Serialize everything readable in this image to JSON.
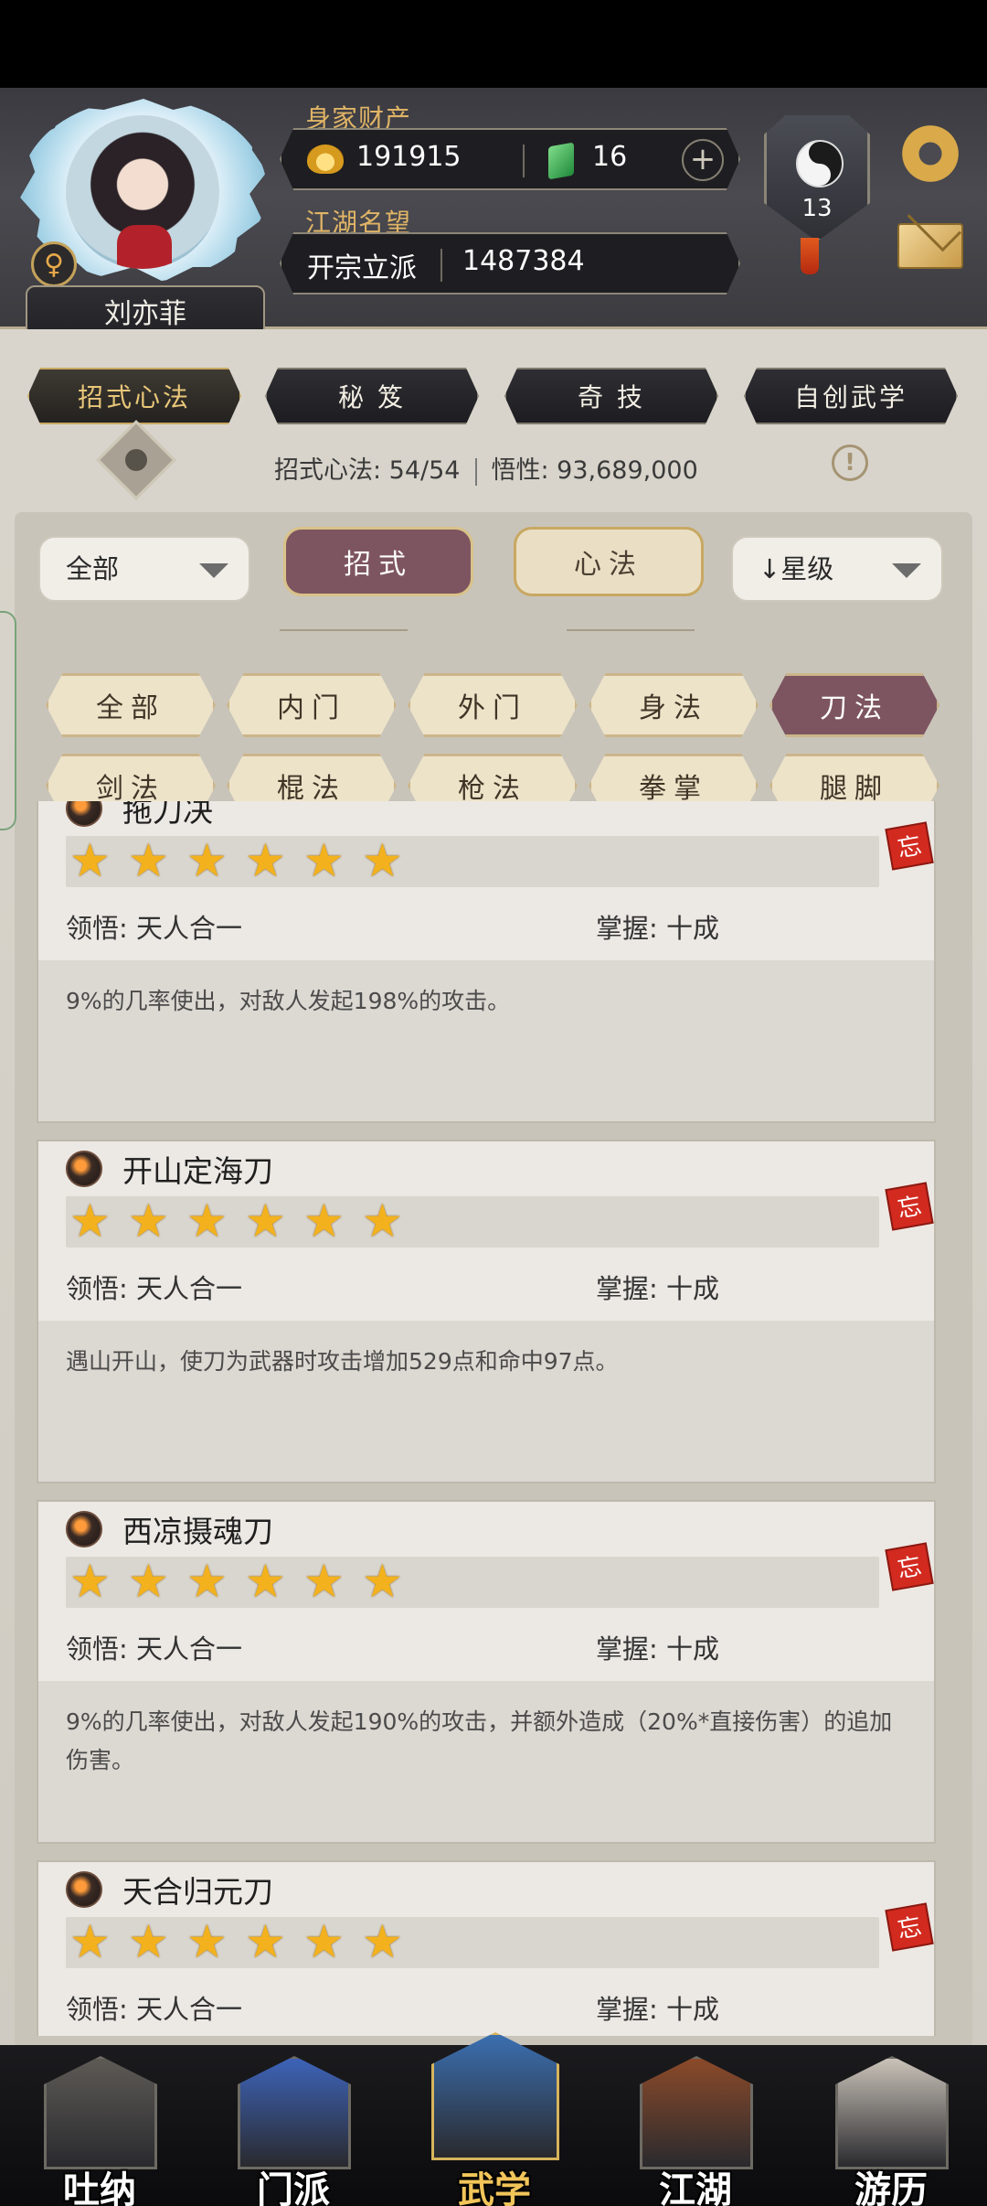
{
  "player": {
    "name": "刘亦菲",
    "gender_symbol": "♀"
  },
  "wealth": {
    "label": "身家财产",
    "gold": "191915",
    "jade": "16",
    "add_symbol": "+"
  },
  "reputation": {
    "label": "江湖名望",
    "rank": "开宗立派",
    "value": "1487384"
  },
  "level": "13",
  "icons": {
    "settings": "gear-icon",
    "mail": "mail-icon",
    "gender": "female-icon",
    "skill": "blade-skill-icon",
    "forget": "forget-seal-icon"
  },
  "top_tabs": [
    {
      "label": "招式心法",
      "active": true
    },
    {
      "label": "秘 笈",
      "active": false
    },
    {
      "label": "奇 技",
      "active": false
    },
    {
      "label": "自创武学",
      "active": false
    }
  ],
  "stats": {
    "moves_label": "招式心法: 54/54",
    "insight_label": "悟性: 93,689,000",
    "info_symbol": "!"
  },
  "filters": {
    "scope_dropdown": "全部",
    "sort_dropdown": "↓星级",
    "segment": [
      {
        "label": "招式",
        "active": true
      },
      {
        "label": "心法",
        "active": false
      }
    ],
    "categories": [
      {
        "label": "全部",
        "active": false
      },
      {
        "label": "内门",
        "active": false
      },
      {
        "label": "外门",
        "active": false
      },
      {
        "label": "身法",
        "active": false
      },
      {
        "label": "刀法",
        "active": true
      },
      {
        "label": "剑法",
        "active": false
      },
      {
        "label": "棍法",
        "active": false
      },
      {
        "label": "枪法",
        "active": false
      },
      {
        "label": "拳掌",
        "active": false
      },
      {
        "label": "腿脚",
        "active": false
      }
    ]
  },
  "skills": [
    {
      "name": "拖刀决",
      "stars": 6,
      "comprehension": "领悟: 天人合一",
      "mastery": "掌握: 十成",
      "description": "9%的几率使出，对敌人发起198%的攻击。"
    },
    {
      "name": "开山定海刀",
      "stars": 6,
      "comprehension": "领悟: 天人合一",
      "mastery": "掌握: 十成",
      "description": "遇山开山，使刀为武器时攻击增加529点和命中97点。"
    },
    {
      "name": "西凉摄魂刀",
      "stars": 6,
      "comprehension": "领悟: 天人合一",
      "mastery": "掌握: 十成",
      "description": "9%的几率使出，对敌人发起190%的攻击，并额外造成（20%*直接伤害）的追加伤害。"
    },
    {
      "name": "天合归元刀",
      "stars": 6,
      "comprehension": "领悟: 天人合一",
      "mastery": "掌握: 十成",
      "description": ""
    }
  ],
  "forget_glyph": "忘",
  "bottom_nav": [
    {
      "label": "吐纳",
      "active": false,
      "color": "#5d5a55"
    },
    {
      "label": "门派",
      "active": false,
      "color": "#3d63b8"
    },
    {
      "label": "武学",
      "active": true,
      "color": "#3b6fb0"
    },
    {
      "label": "江湖",
      "active": false,
      "color": "#8b4a2a"
    },
    {
      "label": "游历",
      "active": false,
      "color": "#c9c2b8"
    }
  ]
}
